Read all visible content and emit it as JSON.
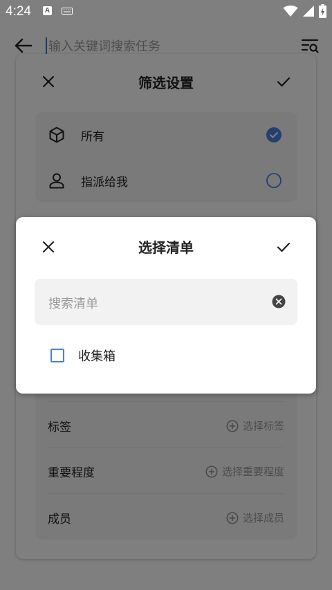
{
  "status_bar": {
    "time": "4:24",
    "a_badge": "A"
  },
  "app_bar": {
    "search_placeholder": "输入关键词搜索任务"
  },
  "filter_panel": {
    "title": "筛选设置",
    "assign_options": [
      {
        "label": "所有",
        "selected": true
      },
      {
        "label": "指派给我",
        "selected": false
      }
    ],
    "rows": [
      {
        "label": "标签",
        "action": "选择标签"
      },
      {
        "label": "重要程度",
        "action": "选择重要程度"
      },
      {
        "label": "成员",
        "action": "选择成员"
      }
    ]
  },
  "dialog": {
    "title": "选择清单",
    "search_placeholder": "搜索清单",
    "options": [
      {
        "label": "收集箱",
        "checked": false
      }
    ]
  },
  "colors": {
    "accent": "#4a7fe0",
    "scrim": "rgba(0,0,0,0.5)"
  }
}
